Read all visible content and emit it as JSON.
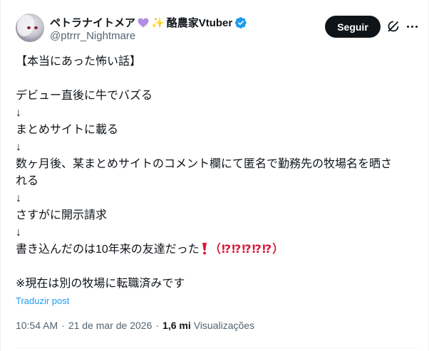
{
  "user": {
    "display_name": "ペトラナイトメア",
    "display_name_suffix": "酪農家Vtuber",
    "handle": "@ptrrr_Nightmare",
    "heart_color": "#b38ee6",
    "verified_color": "#1d9bf0"
  },
  "actions": {
    "follow_label": "Seguir"
  },
  "tweet": {
    "lines": [
      "【本当にあった怖い話】",
      "",
      "デビュー直後に牛でバズる",
      "↓",
      "まとめサイトに載る",
      "↓",
      "数ヶ月後、某まとめサイトのコメント欄にて匿名で勤務先の牧場名を晒さ",
      "れる",
      "↓",
      "さすがに開示請求",
      "↓",
      "書き込んだのは10年来の友達だった",
      "",
      "※現在は別の牧場に転職済みです"
    ],
    "line_after_text": "（⁉⁉⁉⁉⁉）",
    "accent_color": "#d81b3a"
  },
  "translate_label": "Traduzir post",
  "meta": {
    "time": "10:54 AM",
    "separator": "·",
    "date": "21 de mar de 2026",
    "views_count": "1,6 mi",
    "views_label": "Visualizações"
  }
}
